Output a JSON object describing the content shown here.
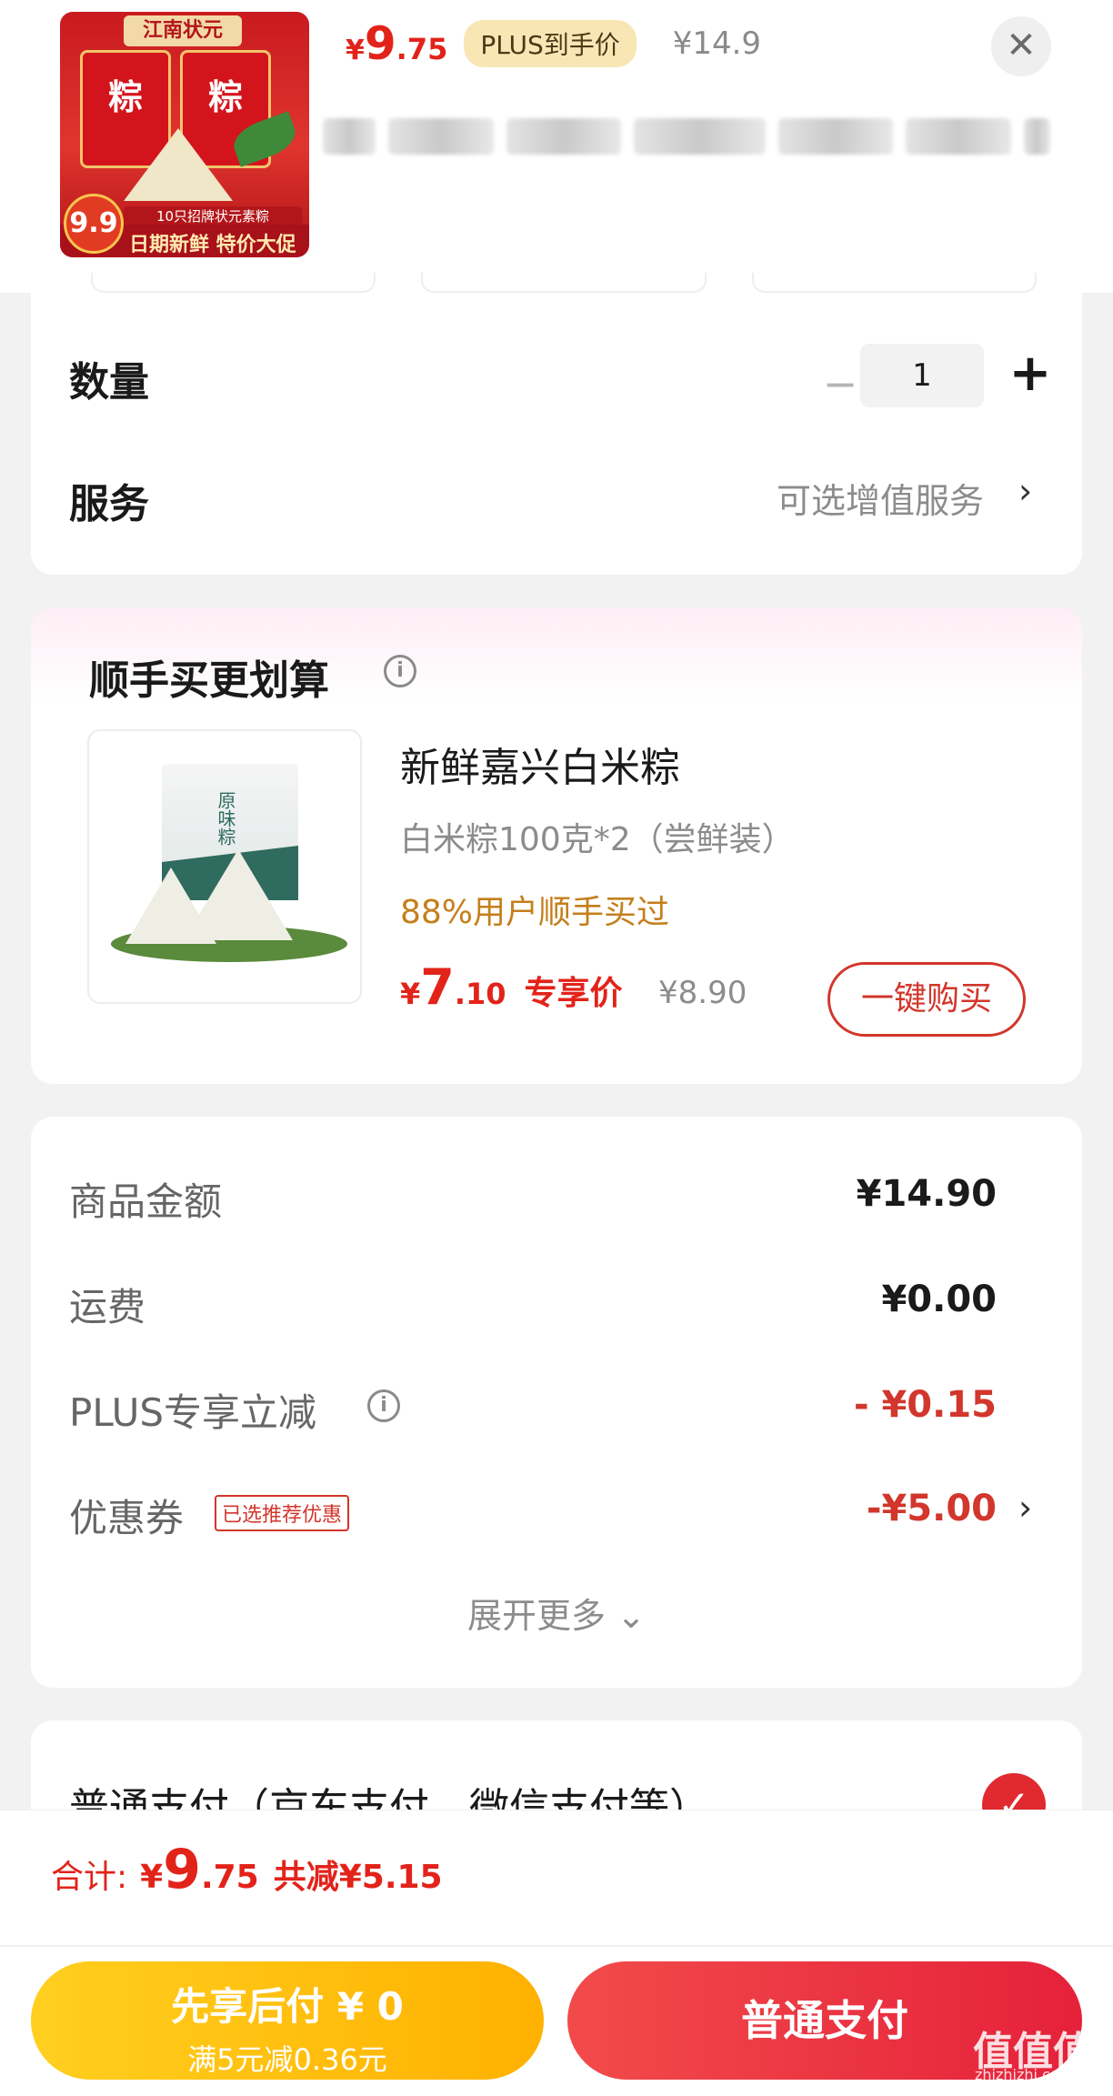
{
  "product": {
    "image_banner": "江南状元",
    "image_bag_text": "粽",
    "image_strip": "10只招牌状元素粽",
    "image_bottom": "日期新鲜 特价大促",
    "image_badge": "9.9",
    "price_symbol": "¥",
    "price_int": "9",
    "price_dec": ".75",
    "plus_tag": "PLUS到手价",
    "original_price": "¥14.9",
    "close_icon": "close-icon"
  },
  "quantity": {
    "label": "数量",
    "minus": "−",
    "value": "1",
    "plus": "+"
  },
  "service": {
    "label": "服务",
    "value": "可选增值服务",
    "chevron": "›"
  },
  "bundle": {
    "title": "顺手买更划算",
    "info": "i",
    "image_label": "原味粽",
    "name": "新鲜嘉兴白米粽",
    "spec": "白米粽100克*2（尝鲜装）",
    "popularity": "88%用户顺手买过",
    "price_symbol": "¥",
    "price_int": "7",
    "price_dec": ".10",
    "price_tag": "专享价",
    "original_price": "¥8.90",
    "buy_button": "一键购买"
  },
  "amounts": {
    "goods_label": "商品金额",
    "goods_value": "¥14.90",
    "shipping_label": "运费",
    "shipping_value": "¥0.00",
    "plus_label": "PLUS专享立减",
    "plus_value": "- ¥0.15",
    "coupon_label": "优惠券",
    "coupon_tag": "已选推荐优惠",
    "coupon_value": "-¥5.00",
    "chevron": "›",
    "expand": "展开更多 ⌄"
  },
  "payment": {
    "method_label": "普通支付（京东支付、微信支付等）",
    "check": "✓"
  },
  "footer": {
    "total_label": "合计:",
    "total_symbol": "¥",
    "total_int": "9",
    "total_dec": ".75",
    "total_saving": "共减¥5.15",
    "later_title": "先享后付 ¥ 0",
    "later_sub": "满5元减0.36元",
    "pay_button": "普通支付"
  },
  "watermark": {
    "text": "值值值",
    "sub": "zhizhizhi.com"
  },
  "colors": {
    "accent_red": "#e2231a",
    "gold": "#ffb100",
    "plus_tag_bg": "#f8e7b5"
  }
}
